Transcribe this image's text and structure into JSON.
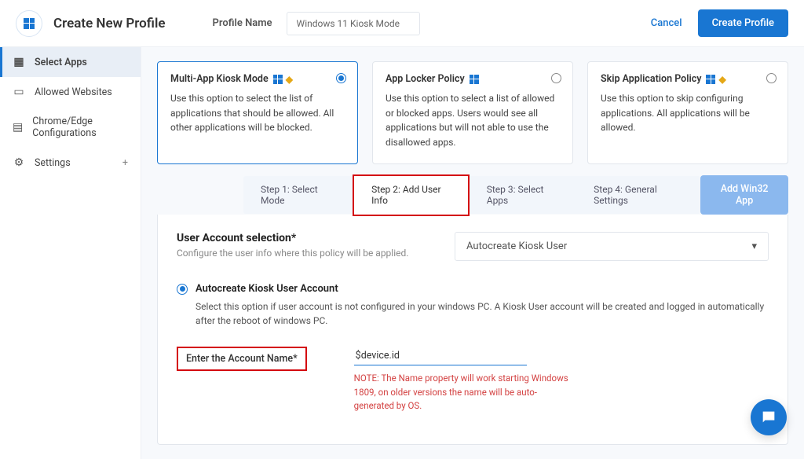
{
  "header": {
    "title": "Create New Profile",
    "profile_name_label": "Profile Name",
    "profile_name_value": "Windows 11 Kiosk Mode",
    "cancel": "Cancel",
    "create": "Create Profile"
  },
  "sidebar": {
    "items": [
      {
        "label": "Select Apps",
        "icon": "grid"
      },
      {
        "label": "Allowed Websites",
        "icon": "browser"
      },
      {
        "label": "Chrome/Edge Configurations",
        "icon": "card"
      },
      {
        "label": "Settings",
        "icon": "gear",
        "has_plus": true
      }
    ]
  },
  "mode_cards": [
    {
      "title": "Multi-App Kiosk Mode",
      "shows_win": true,
      "shows_shield": true,
      "desc": "Use this option to select the list of applications that should be allowed. All other applications will be blocked.",
      "selected": true
    },
    {
      "title": "App Locker Policy",
      "shows_win": true,
      "shows_shield": false,
      "desc": "Use this option to select a list of allowed or blocked apps. Users would see all applications but will not able to use the disallowed apps.",
      "selected": false
    },
    {
      "title": "Skip Application Policy",
      "shows_win": true,
      "shows_shield": true,
      "desc": "Use this option to skip configuring applications. All applications will be allowed.",
      "selected": false
    }
  ],
  "steps": [
    "Step 1: Select Mode",
    "Step 2: Add User Info",
    "Step 3: Select Apps",
    "Step 4: General Settings"
  ],
  "add_win32": "Add Win32 App",
  "panel": {
    "title": "User Account selection*",
    "sub": "Configure the user info where this policy will be applied.",
    "dropdown_value": "Autocreate Kiosk User",
    "option_title": "Autocreate Kiosk User Account",
    "option_desc": "Select this option if user account is not configured in your windows PC. A Kiosk User account will be created and logged in automatically after the reboot of windows PC.",
    "field_label": "Enter the Account Name*",
    "field_value": "$device.id",
    "field_note": "NOTE: The Name property will work starting Windows 1809, on older versions the name will be auto-generated by OS."
  }
}
